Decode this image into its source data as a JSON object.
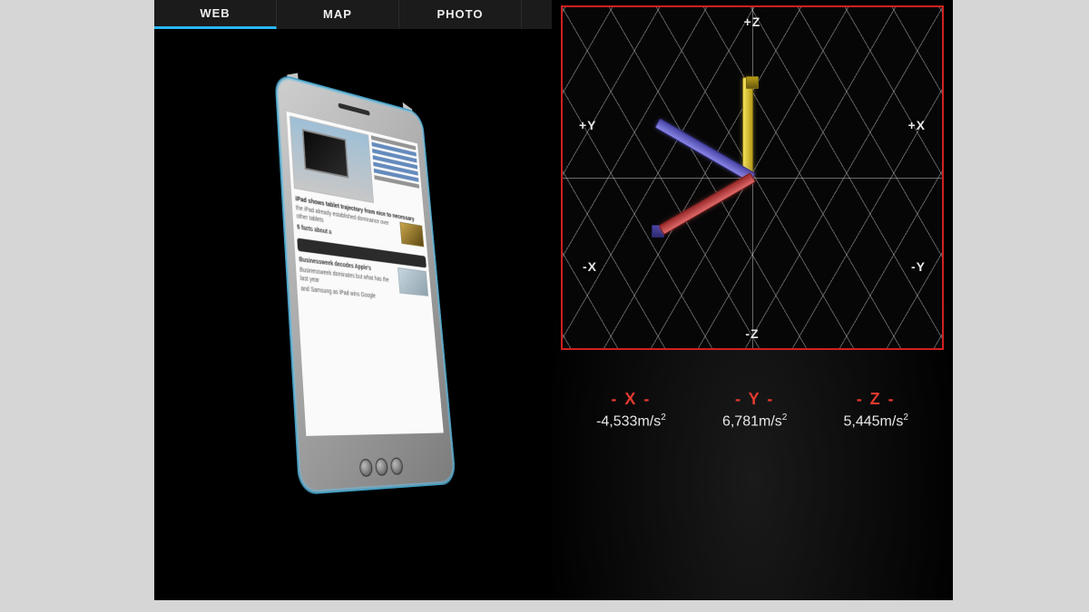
{
  "tabs": {
    "web": "WEB",
    "map": "MAP",
    "photo": "PHOTO"
  },
  "active_tab": "web",
  "phone_screen": {
    "headline": "iPad shows tablet trajectory from nice to necessary",
    "sidelinks": [
      "iPad: Apple sends de-",
      "won't find it to where",
      "iPad 3: What we didn't",
      "4G LTE: Long way to",
      "The new iPad: Pre-",
      "Source: Read the"
    ],
    "sidebar_title": "5 facts about a",
    "para1": "the iPad already established dominance over other tablets",
    "subhead1": "Businessweek decodes Apple's",
    "subhead2": "Businessweek dominates but what has the last year",
    "footer_line": "and Samsung as iPad wins Google"
  },
  "axes": {
    "pz": "+Z",
    "nz": "-Z",
    "py": "+Y",
    "ny": "-Y",
    "px": "+X",
    "nx": "-X"
  },
  "readouts": {
    "x": {
      "label": "- X -",
      "value_text": "-4,533m/s",
      "exp": "2"
    },
    "y": {
      "label": "- Y -",
      "value_text": "6,781m/s",
      "exp": "2"
    },
    "z": {
      "label": "- Z -",
      "value_text": "5,445m/s",
      "exp": "2"
    }
  },
  "sensor_values": {
    "x": -4.533,
    "y": 6.781,
    "z": 5.445,
    "unit": "m/s^2"
  }
}
